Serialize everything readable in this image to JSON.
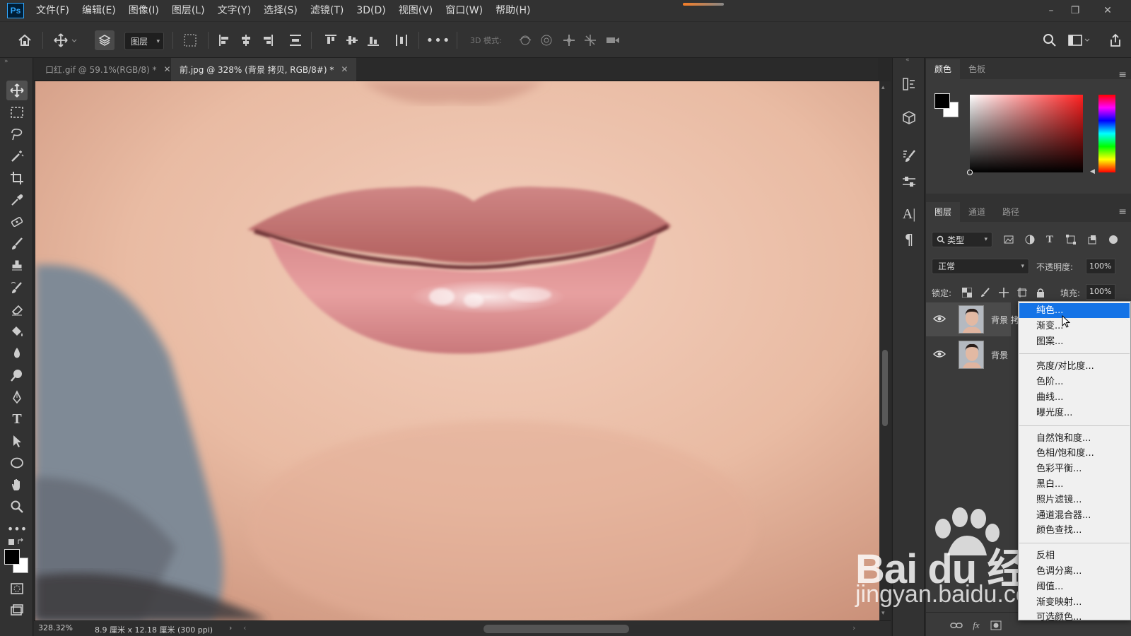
{
  "app": {
    "logo": "Ps",
    "menu": [
      "文件(F)",
      "编辑(E)",
      "图像(I)",
      "图层(L)",
      "文字(Y)",
      "选择(S)",
      "滤镜(T)",
      "3D(D)",
      "视图(V)",
      "窗口(W)",
      "帮助(H)"
    ]
  },
  "options_bar": {
    "layer_select": "图层",
    "mode_3d_label": "3D 模式:"
  },
  "tabs": [
    {
      "label": "口红.gif @ 59.1%(RGB/8) *",
      "active": false
    },
    {
      "label": "前.jpg @ 328% (背景 拷贝, RGB/8#) *",
      "active": true
    }
  ],
  "status": {
    "zoom": "328.32%",
    "doc_size": "8.9 厘米 x 12.18 厘米 (300 ppi)"
  },
  "color_panel": {
    "tabs": [
      "颜色",
      "色板"
    ],
    "foreground": "#000000",
    "background": "#ffffff"
  },
  "layers_panel": {
    "tabs": [
      "图层",
      "通道",
      "路径"
    ],
    "filter_kind": "类型",
    "blend_mode": "正常",
    "opacity_label": "不透明度:",
    "opacity_value": "100%",
    "lock_label": "锁定:",
    "fill_label": "填充:",
    "fill_value": "100%",
    "layers": [
      {
        "name": "背景 拷",
        "selected": true
      },
      {
        "name": "背景",
        "selected": false
      }
    ]
  },
  "adjustment_menu": {
    "groups": [
      [
        "纯色...",
        "渐变...",
        "图案..."
      ],
      [
        "亮度/对比度...",
        "色阶...",
        "曲线...",
        "曝光度..."
      ],
      [
        "自然饱和度...",
        "色相/饱和度...",
        "色彩平衡...",
        "黑白...",
        "照片滤镜...",
        "通道混合器...",
        "颜色查找..."
      ],
      [
        "反相",
        "色调分离...",
        "阈值...",
        "渐变映射...",
        "可选颜色..."
      ]
    ],
    "highlighted": "纯色..."
  },
  "watermark": {
    "logo": "Bai du 经验",
    "url": "jingyan.baidu.com"
  }
}
